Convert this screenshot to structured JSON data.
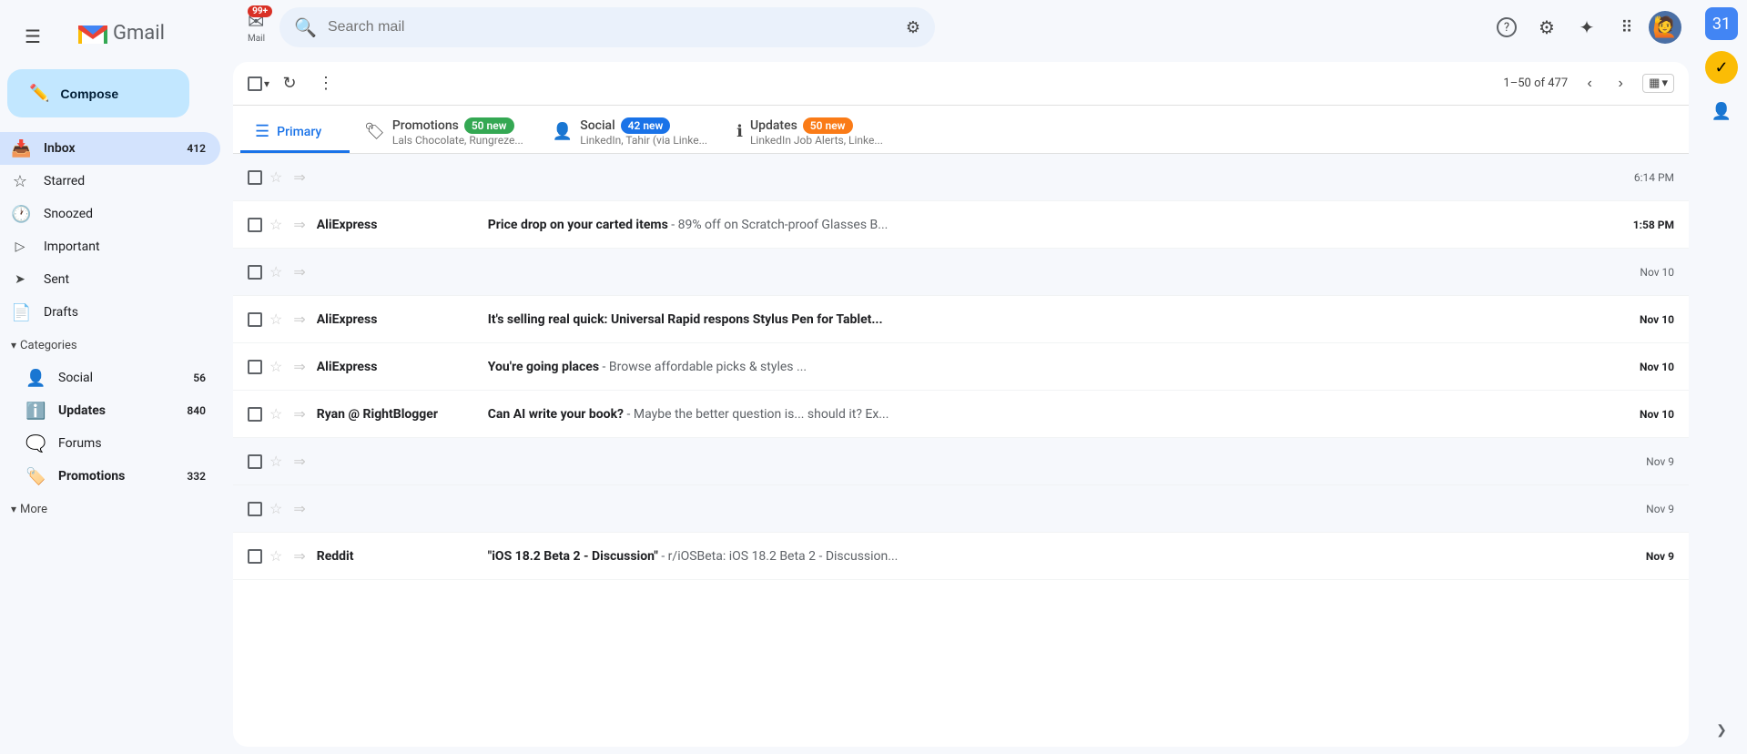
{
  "app": {
    "title": "Gmail",
    "logo_m": "M",
    "logo_text": "Gmail"
  },
  "compose": {
    "label": "Compose",
    "icon": "✏️"
  },
  "notification_badge": "99+",
  "sidebar": {
    "items": [
      {
        "id": "inbox",
        "label": "Inbox",
        "icon": "📥",
        "count": "412",
        "active": true
      },
      {
        "id": "starred",
        "label": "Starred",
        "icon": "☆",
        "count": ""
      },
      {
        "id": "snoozed",
        "label": "Snoozed",
        "icon": "🕐",
        "count": ""
      },
      {
        "id": "important",
        "label": "Important",
        "icon": "▷",
        "count": ""
      },
      {
        "id": "sent",
        "label": "Sent",
        "icon": "➤",
        "count": ""
      },
      {
        "id": "drafts",
        "label": "Drafts",
        "icon": "📄",
        "count": ""
      }
    ],
    "categories_label": "Categories",
    "categories": [
      {
        "id": "social",
        "label": "Social",
        "icon": "👤",
        "count": "56"
      },
      {
        "id": "updates",
        "label": "Updates",
        "icon": "ℹ️",
        "count": "840"
      },
      {
        "id": "forums",
        "label": "Forums",
        "icon": "🗨️",
        "count": ""
      },
      {
        "id": "promotions",
        "label": "Promotions",
        "icon": "🏷️",
        "count": "332"
      }
    ],
    "more_label": "More"
  },
  "header": {
    "search_placeholder": "Search mail",
    "help_icon": "?",
    "settings_icon": "⚙",
    "gemini_icon": "✦",
    "apps_icon": "⋮⋮⋮"
  },
  "toolbar": {
    "pagination": "1–50 of 477",
    "more_options_label": "More"
  },
  "tabs": [
    {
      "id": "primary",
      "label": "Primary",
      "icon": "☰",
      "active": true,
      "badge": null,
      "preview": null
    },
    {
      "id": "promotions",
      "label": "Promotions",
      "icon": "🏷",
      "active": false,
      "badge": "50 new",
      "badge_color": "green",
      "preview": "Lals Chocolate, Rungreze..."
    },
    {
      "id": "social",
      "label": "Social",
      "icon": "👤",
      "active": false,
      "badge": "42 new",
      "badge_color": "blue",
      "preview": "LinkedIn, Tahir (via Linke..."
    },
    {
      "id": "updates",
      "label": "Updates",
      "icon": "ℹ",
      "active": false,
      "badge": "50 new",
      "badge_color": "orange",
      "preview": "LinkedIn Job Alerts, Linke..."
    }
  ],
  "emails": [
    {
      "id": 1,
      "sender": "",
      "subject": "",
      "preview": "",
      "time": "6:14 PM",
      "unread": false,
      "starred": false,
      "blank": true
    },
    {
      "id": 2,
      "sender": "AliExpress",
      "subject": "Price drop on your carted items",
      "preview": " - 89% off on Scratch-proof Glasses B...",
      "time": "1:58 PM",
      "unread": true,
      "starred": false,
      "blank": false
    },
    {
      "id": 3,
      "sender": "",
      "subject": "",
      "preview": "",
      "time": "Nov 10",
      "unread": false,
      "starred": false,
      "blank": true
    },
    {
      "id": 4,
      "sender": "AliExpress",
      "subject": "It's selling real quick: Universal Rapid respons Stylus Pen for Tablet...",
      "preview": "",
      "time": "Nov 10",
      "unread": true,
      "starred": false,
      "blank": false
    },
    {
      "id": 5,
      "sender": "AliExpress",
      "subject": "You're going places",
      "preview": " - Browse affordable picks & styles",
      "time": "Nov 10",
      "unread": true,
      "starred": false,
      "blank": false,
      "has_ellipsis": true
    },
    {
      "id": 6,
      "sender": "Ryan @ RightBlogger",
      "subject": "Can AI write your book?",
      "preview": " - Maybe the better question is... should it? Ex...",
      "time": "Nov 10",
      "unread": true,
      "starred": false,
      "blank": false
    },
    {
      "id": 7,
      "sender": "",
      "subject": "",
      "preview": "",
      "time": "Nov 9",
      "unread": false,
      "starred": false,
      "blank": true
    },
    {
      "id": 8,
      "sender": "",
      "subject": "",
      "preview": "",
      "time": "Nov 9",
      "unread": false,
      "starred": false,
      "blank": true
    },
    {
      "id": 9,
      "sender": "Reddit",
      "subject": "\"iOS 18.2 Beta 2 - Discussion\"",
      "preview": " - r/iOSBeta: iOS 18.2 Beta 2 - Discussion...",
      "time": "Nov 9",
      "unread": true,
      "starred": false,
      "blank": false
    }
  ],
  "right_panel": {
    "calendar_icon": "📅",
    "tasks_icon": "✅",
    "contacts_icon": "👤",
    "expand_icon": "❯"
  }
}
